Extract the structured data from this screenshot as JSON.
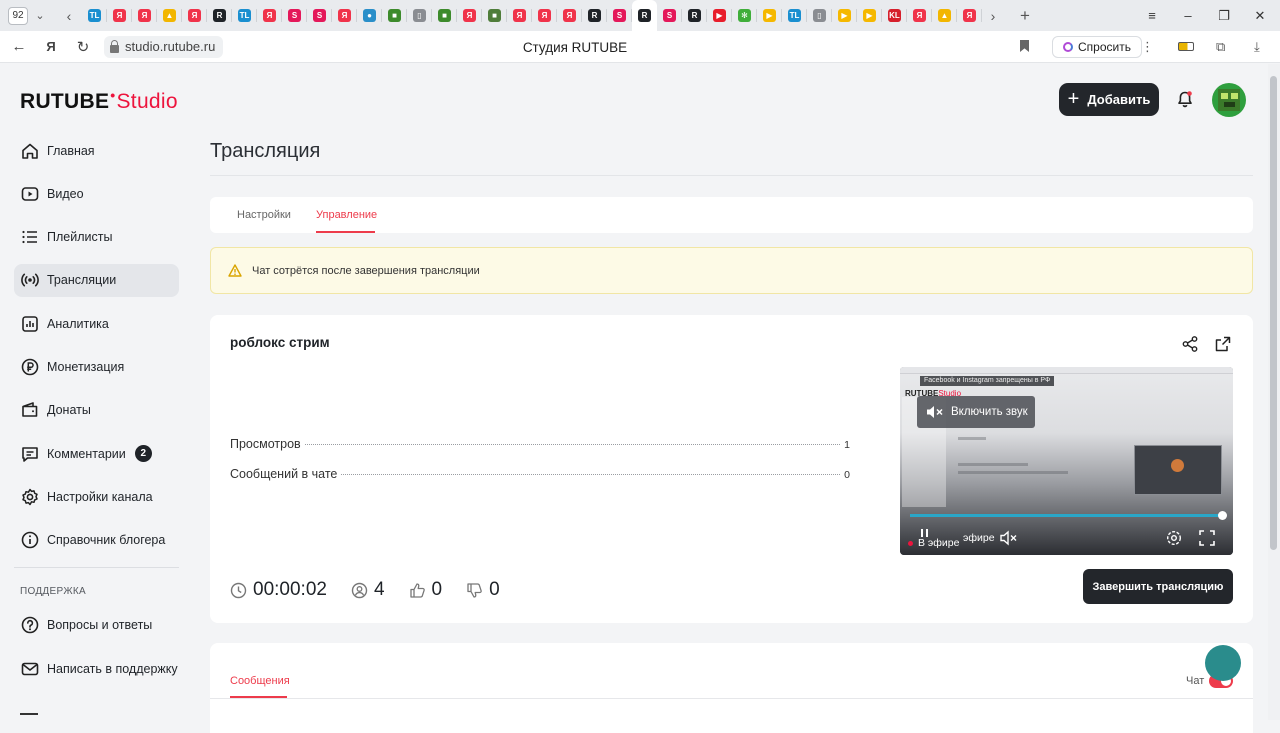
{
  "browser": {
    "tab_count": "92",
    "page_title": "Студия RUTUBE",
    "url": "studio.rutube.ru",
    "ask_label": "Спросить",
    "tab_icons": [
      {
        "name": "tl-tab-icon",
        "color": "#1a8fd0",
        "glyph": "TL"
      },
      {
        "name": "yandex-tab-icon",
        "color": "#f0334a",
        "glyph": "Я"
      },
      {
        "name": "yandex-tab-icon",
        "color": "#f0334a",
        "glyph": "Я"
      },
      {
        "name": "mountain-tab-icon",
        "color": "#f2b600",
        "glyph": "▲"
      },
      {
        "name": "yandex-tab-icon",
        "color": "#f0334a",
        "glyph": "Я"
      },
      {
        "name": "rutube-tab-icon",
        "color": "#1f2328",
        "glyph": "R"
      },
      {
        "name": "tl-tab-icon",
        "color": "#1a8fd0",
        "glyph": "TL"
      },
      {
        "name": "yandex-tab-icon",
        "color": "#f0334a",
        "glyph": "Я"
      },
      {
        "name": "s-tab-icon",
        "color": "#e4185a",
        "glyph": "S"
      },
      {
        "name": "s-tab-icon",
        "color": "#e4185a",
        "glyph": "S"
      },
      {
        "name": "yandex-tab-icon",
        "color": "#f0334a",
        "glyph": "Я"
      },
      {
        "name": "globe-tab-icon",
        "color": "#2a8fc9",
        "glyph": "●"
      },
      {
        "name": "minecraft-tab-icon",
        "color": "#3d8b2c",
        "glyph": "■"
      },
      {
        "name": "doc-tab-icon",
        "color": "#8a8d92",
        "glyph": "▯"
      },
      {
        "name": "minecraft-tab-icon",
        "color": "#3d8b2c",
        "glyph": "■"
      },
      {
        "name": "yandex-tab-icon",
        "color": "#f0334a",
        "glyph": "Я"
      },
      {
        "name": "minecraft-tab-icon",
        "color": "#4f7d3a",
        "glyph": "■"
      },
      {
        "name": "yandex-tab-icon",
        "color": "#f0334a",
        "glyph": "Я"
      },
      {
        "name": "yandex-tab-icon",
        "color": "#f0334a",
        "glyph": "Я"
      },
      {
        "name": "yandex-tab-icon",
        "color": "#f0334a",
        "glyph": "Я"
      },
      {
        "name": "rutube-tab-icon",
        "color": "#1f2328",
        "glyph": "R"
      },
      {
        "name": "s-tab-icon",
        "color": "#e4185a",
        "glyph": "S"
      },
      {
        "name": "rutube-tab-icon",
        "color": "#1f2328",
        "glyph": "R"
      },
      {
        "name": "s-tab-icon",
        "color": "#e4185a",
        "glyph": "S"
      },
      {
        "name": "rutube-tab-icon",
        "color": "#1f2328",
        "glyph": "R"
      },
      {
        "name": "youtube-tab-icon",
        "color": "#e81d2b",
        "glyph": "▶"
      },
      {
        "name": "gear-tab-icon",
        "color": "#3fae3a",
        "glyph": "✻"
      },
      {
        "name": "play-tab-icon",
        "color": "#f5b800",
        "glyph": "▶"
      },
      {
        "name": "tl-tab-icon",
        "color": "#1a8fd0",
        "glyph": "TL"
      },
      {
        "name": "doc-tab-icon",
        "color": "#8a8d92",
        "glyph": "▯"
      },
      {
        "name": "play-tab-icon",
        "color": "#f5b800",
        "glyph": "▶"
      },
      {
        "name": "play-tab-icon",
        "color": "#f5b800",
        "glyph": "▶"
      },
      {
        "name": "kl-tab-icon",
        "color": "#d61f2c",
        "glyph": "KL"
      },
      {
        "name": "yandex-tab-icon",
        "color": "#f0334a",
        "glyph": "Я"
      },
      {
        "name": "mountain-tab-icon",
        "color": "#f2b600",
        "glyph": "▲"
      },
      {
        "name": "yandex-tab-icon",
        "color": "#f0334a",
        "glyph": "Я"
      }
    ]
  },
  "header": {
    "logo_main": "RUTUBE",
    "logo_sub": "Studio",
    "add_label": "Добавить"
  },
  "sidebar": {
    "items": [
      {
        "label": "Главная",
        "icon": "home-icon"
      },
      {
        "label": "Видео",
        "icon": "video-icon"
      },
      {
        "label": "Плейлисты",
        "icon": "playlist-icon"
      },
      {
        "label": "Трансляции",
        "icon": "broadcast-icon",
        "active": true
      },
      {
        "label": "Аналитика",
        "icon": "analytics-icon"
      },
      {
        "label": "Монетизация",
        "icon": "ruble-icon"
      },
      {
        "label": "Донаты",
        "icon": "wallet-icon"
      },
      {
        "label": "Комментарии",
        "icon": "comment-icon",
        "badge": "2"
      },
      {
        "label": "Настройки канала",
        "icon": "gear-icon"
      },
      {
        "label": "Справочник блогера",
        "icon": "info-icon"
      }
    ],
    "support_label": "ПОДДЕРЖКА",
    "support_items": [
      {
        "label": "Вопросы и ответы",
        "icon": "question-icon"
      },
      {
        "label": "Написать в поддержку",
        "icon": "mail-icon"
      }
    ]
  },
  "main": {
    "title": "Трансляция",
    "tabs": [
      {
        "label": "Настройки"
      },
      {
        "label": "Управление",
        "active": true
      }
    ],
    "alert": "Чат сотрётся после завершения трансляции",
    "stream": {
      "title": "роблокс стрим",
      "stats": [
        {
          "label": "Просмотров",
          "value": "1"
        },
        {
          "label": "Сообщений в чате",
          "value": "0"
        }
      ],
      "duration": "00:00:02",
      "viewers": "4",
      "likes": "0",
      "dislikes": "0",
      "end_label": "Завершить трансляцию"
    },
    "player": {
      "unmute_label": "Включить звук",
      "live_label": "В эфире",
      "live_label_echo": "эфире",
      "preview_toast": "Facebook и Instagram запрещены в РФ",
      "preview_logo": "RUTUBE",
      "preview_logo_sub": "Studio",
      "progress": 1.0,
      "accent": "#2aa6c8"
    },
    "messages": {
      "tab_label": "Сообщения",
      "chat_label": "Чат",
      "chat_enabled": true
    }
  },
  "colors": {
    "accent_red": "#ed3b4b",
    "brand_red": "#ed143d",
    "dark_button": "#23262b"
  }
}
